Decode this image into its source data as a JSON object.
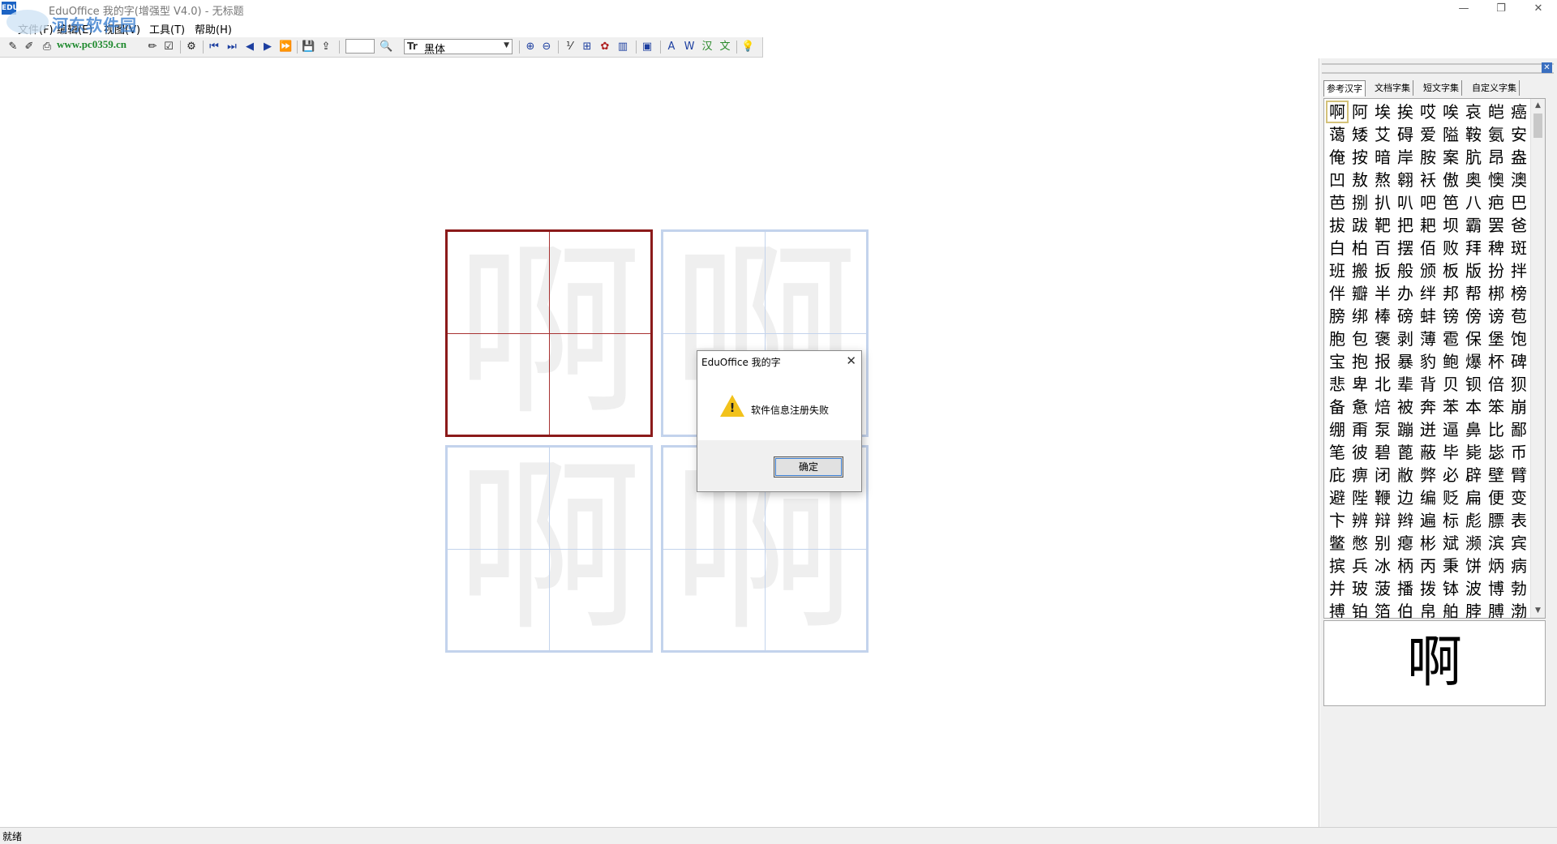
{
  "window": {
    "title": "EduOffice 我的字(增强型 V4.0) - 无标题",
    "app_icon_label": "EDU",
    "controls": {
      "minimize": "—",
      "maximize": "❐",
      "close": "✕"
    }
  },
  "watermark": {
    "site": "河东软件园",
    "url": "www.pc0359.cn"
  },
  "menu": [
    "文件(F)",
    "编辑(E)",
    "视图(V)",
    "工具(T)",
    "帮助(H)"
  ],
  "toolbar": {
    "font_glyph": "Tr",
    "font_value": "黑体",
    "buttons": [
      "new-icon",
      "open-icon",
      "print-icon",
      "pencil-icon",
      "brush-icon",
      "edit-icon",
      "tools-icon",
      "first-icon",
      "last-icon",
      "prev-icon",
      "next-icon",
      "end-icon",
      "save-icon",
      "export-icon",
      "search-icon",
      "zoom-in-icon",
      "zoom-out-icon",
      "actual-size-icon",
      "grid-icon",
      "style-icon",
      "layout-icon",
      "frame-icon",
      "text-icon",
      "word-icon",
      "hanzi-icon",
      "char-icon",
      "help-icon"
    ]
  },
  "canvas": {
    "practice_char": "啊"
  },
  "dialog": {
    "title": "EduOffice 我的字",
    "message": "软件信息注册失败",
    "ok_label": "确定",
    "close": "✕",
    "warn_mark": "!"
  },
  "panel": {
    "close": "✕",
    "tabs": [
      "参考汉字",
      "文档字集",
      "短文字集",
      "自定义字集"
    ],
    "active_tab": 0,
    "chars": "啊阿埃挨哎唉哀皑癌蔼矮艾碍爱隘鞍氨安俺按暗岸胺案肮昂盎凹敖熬翱袄傲奥懊澳芭捌扒叭吧笆八疤巴拔跋靶把耙坝霸罢爸白柏百摆佰败拜稗斑班搬扳般颁板版扮拌伴瓣半办绊邦帮梆榜膀绑棒磅蚌镑傍谤苞胞包褒剥薄雹保堡饱宝抱报暴豹鲍爆杯碑悲卑北辈背贝钡倍狈备惫焙被奔苯本笨崩绷甭泵蹦迸逼鼻比鄙笔彼碧蓖蔽毕毙毖币庇痹闭敝弊必辟壁臂避陛鞭边编贬扁便变卞辨辩辫遍标彪膘表鳖憋别瘪彬斌濒滨宾摈兵冰柄丙秉饼炳病并玻菠播拨钵波博勃搏铂箔伯帛舶脖膊渤泊驳捕卜哺补埠不布步簿部怖擦猜裁材才财睬踩采彩菜蔡餐参蚕残惭惨灿苍舱仓沧藏操糙槽曹草厕策侧",
    "selected_index": 0,
    "preview_char": "啊",
    "scroll": {
      "up": "▲",
      "down": "▼"
    }
  },
  "status": {
    "text": "就绪"
  }
}
